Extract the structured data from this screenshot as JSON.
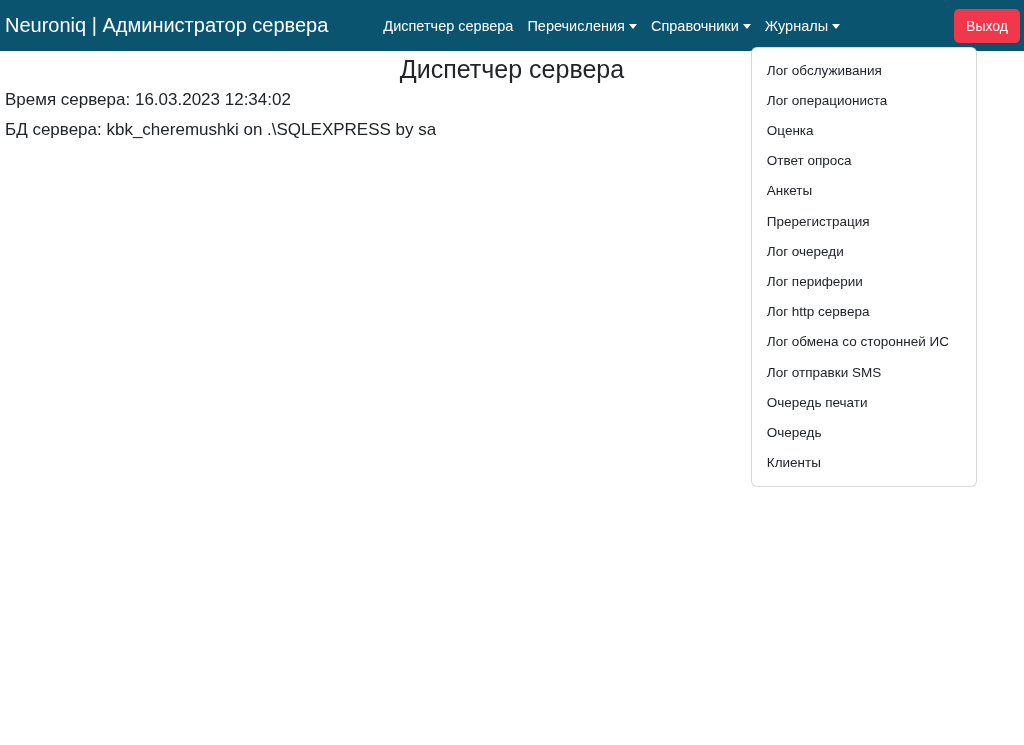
{
  "navbar": {
    "brand": "Neuroniq | Администратор сервера",
    "items": [
      {
        "kind": "link",
        "label": "Диспетчер сервера"
      },
      {
        "kind": "dropdown",
        "label": "Перечисления"
      },
      {
        "kind": "dropdown",
        "label": "Справочники"
      },
      {
        "kind": "dropdown",
        "label": "Журналы",
        "menu": [
          "Лог обслуживания",
          "Лог операциониста",
          "Оценка",
          "Ответ опроса",
          "Анкеты",
          "Пререгистрация",
          "Лог очереди",
          "Лог периферии",
          "Лог http сервера",
          "Лог обмена со сторонней ИС",
          "Лог отправки SMS",
          "Очередь печати",
          "Очередь",
          "Клиенты"
        ]
      }
    ],
    "logout": "Выход"
  },
  "page": {
    "title": "Диспетчер сервера",
    "lines": [
      "Время сервера: 16.03.2023 12:34:02",
      "БД сервера: kbk_cheremushki on .\\SQLEXPRESS by sa"
    ]
  }
}
